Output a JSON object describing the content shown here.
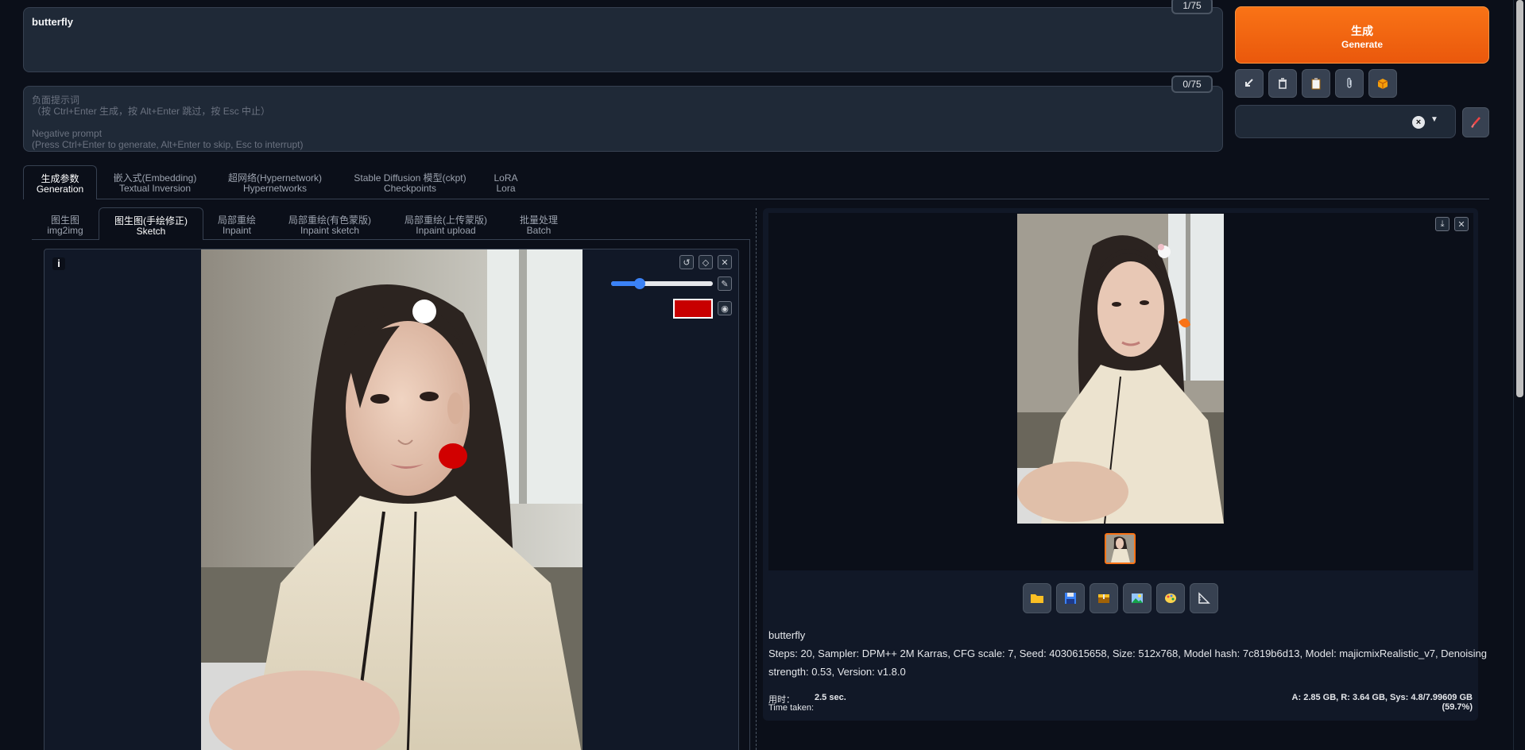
{
  "prompt": {
    "value": "butterfly",
    "counter": "1/75"
  },
  "negative_prompt": {
    "counter": "0/75",
    "placeholder": "负面提示词\n（按 Ctrl+Enter 生成，按 Alt+Enter 跳过，按 Esc 中止）\n\nNegative prompt\n(Press Ctrl+Enter to generate, Alt+Enter to skip, Esc to interrupt)"
  },
  "generate": {
    "label_cn": "生成",
    "label_en": "Generate"
  },
  "toolbar_icons": [
    "arrow-down-left-icon",
    "trash-icon",
    "clipboard-icon",
    "paperclip-icon",
    "box-icon"
  ],
  "main_tabs": [
    {
      "cn": "生成参数",
      "en": "Generation"
    },
    {
      "cn": "嵌入式(Embedding)",
      "en": "Textual Inversion"
    },
    {
      "cn": "超网络(Hypernetwork)",
      "en": "Hypernetworks"
    },
    {
      "cn": "Stable Diffusion 模型(ckpt)",
      "en": "Checkpoints"
    },
    {
      "cn": "LoRA",
      "en": "Lora"
    }
  ],
  "sub_tabs": [
    {
      "cn": "图生图",
      "en": "img2img"
    },
    {
      "cn": "图生图(手绘修正)",
      "en": "Sketch"
    },
    {
      "cn": "局部重绘",
      "en": "Inpaint"
    },
    {
      "cn": "局部重绘(有色蒙版)",
      "en": "Inpaint sketch"
    },
    {
      "cn": "局部重绘(上传蒙版)",
      "en": "Inpaint upload"
    },
    {
      "cn": "批量处理",
      "en": "Batch"
    }
  ],
  "sketch": {
    "info_label": "i",
    "brush_color": "#c80000",
    "brush_size": 0.28
  },
  "output_buttons": [
    "folder-icon",
    "save-icon",
    "zip-icon",
    "image-icon",
    "palette-icon",
    "ruler-icon"
  ],
  "output_info": {
    "prompt": "butterfly",
    "params_line1": "Steps: 20, Sampler: DPM++ 2M Karras, CFG scale: 7, Seed: 4030615658, Size: 512x768, Model hash: 7c819b6d13, Model: majicmixRealistic_v7, Denoising",
    "params_line2": "strength: 0.53, Version: v1.8.0",
    "time_label_cn": "用时：",
    "time_label_en": "Time taken:",
    "time_value": "2.5 sec.",
    "vram": "A: 2.85 GB, R: 3.64 GB, Sys: 4.8/7.99609 GB (59.7%)"
  },
  "colors": {
    "accent": "#f97316",
    "background": "#0b0f19",
    "panel": "#1f2937"
  }
}
